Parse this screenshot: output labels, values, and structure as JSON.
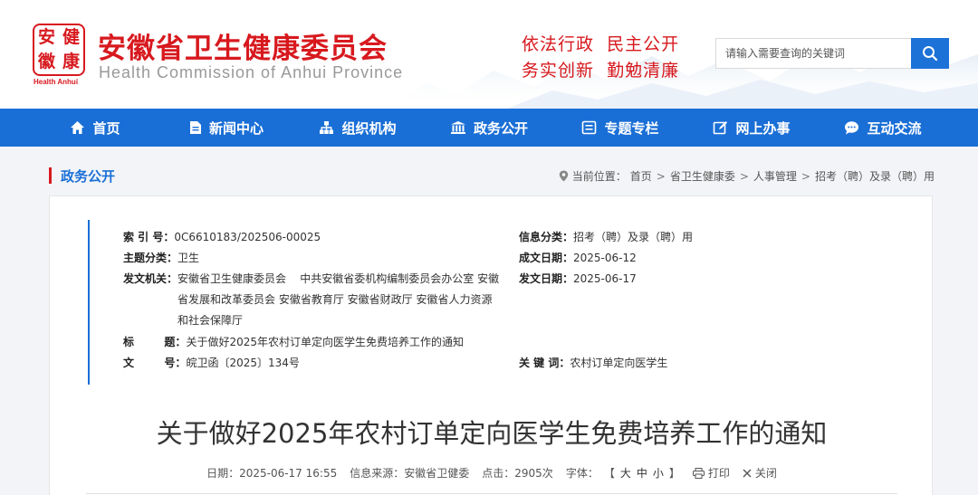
{
  "header": {
    "logo_chars": [
      "安",
      "健",
      "徽",
      "康"
    ],
    "logo_caption": "Health Anhui",
    "title": "安徽省卫生健康委员会",
    "subtitle": "Health Commission of Anhui Province",
    "slogan_line1": "依法行政  民主公开",
    "slogan_line2": "务实创新  勤勉清廉",
    "search": {
      "placeholder": "请输入需要查询的关键词",
      "value": ""
    }
  },
  "nav": {
    "items": [
      {
        "label": "首页",
        "icon": "home-icon"
      },
      {
        "label": "新闻中心",
        "icon": "document-icon"
      },
      {
        "label": "组织机构",
        "icon": "org-chart-icon"
      },
      {
        "label": "政务公开",
        "icon": "government-building-icon"
      },
      {
        "label": "专题专栏",
        "icon": "topic-card-icon"
      },
      {
        "label": "网上办事",
        "icon": "edit-icon"
      },
      {
        "label": "互动交流",
        "icon": "chat-bubble-icon"
      }
    ]
  },
  "breadcrumb": {
    "section": "政务公开",
    "prefix": "当前位置：",
    "items": [
      "首页",
      "省卫生健康委",
      "人事管理",
      "招考（聘）及录（聘）用"
    ]
  },
  "meta": {
    "index_label": "索 引 号：",
    "index_value": "0C6610183/202506-00025",
    "info_cat_label": "信息分类：",
    "info_cat_value": "招考（聘）及录（聘）用",
    "topic_label": "主题分类：",
    "topic_value": "卫生",
    "created_label": "成文日期：",
    "created_value": "2025-06-12",
    "issuer_label": "发文机关：",
    "issuer_line1": "安徽省卫生健康委员会    中共安徽省委机构编制委员会办公室 安徽",
    "issuer_line2": "省发展和改革委员会 安徽省教育厅 安徽省财政厅 安徽省人力资源",
    "issuer_line3": "和社会保障厅",
    "published_label": "发文日期：",
    "published_value": "2025-06-17",
    "title_label": "标        题：",
    "title_value": "关于做好2025年农村订单定向医学生免费培养工作的通知",
    "doc_no_label": "文        号：",
    "doc_no_value": "皖卫函〔2025〕134号",
    "keywords_label": "关 键 词：",
    "keywords_value": "农村订单定向医学生"
  },
  "article": {
    "title": "关于做好2025年农村订单定向医学生免费培养工作的通知",
    "date_label": "日期：",
    "date_value": "2025-06-17 16:55",
    "source_label": "信息来源：",
    "source_value": "安徽省卫健委",
    "hits_label": "点击：",
    "hits_value": "2905次",
    "font_label": "字体：",
    "bracket_open": "【",
    "size_large": "大",
    "size_medium": "中",
    "size_small": "小",
    "bracket_close": "】",
    "print_label": "打印",
    "close_label": "关闭"
  },
  "colors": {
    "brand_red": "#d7191e",
    "nav_blue": "#1a6fd6",
    "search_blue": "#1d72d8"
  }
}
